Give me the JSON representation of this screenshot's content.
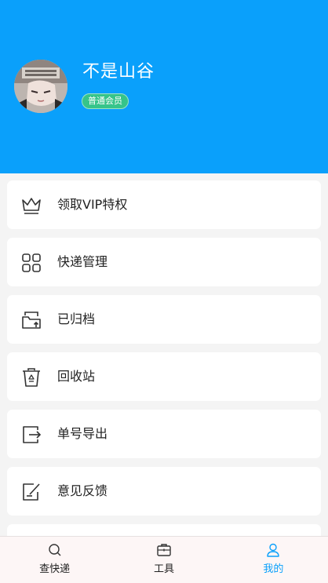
{
  "profile": {
    "username": "不是山谷",
    "badge": "普通会员"
  },
  "menu": {
    "items": [
      {
        "label": "领取VIP特权",
        "icon": "crown-icon"
      },
      {
        "label": "快递管理",
        "icon": "grid-icon"
      },
      {
        "label": "已归档",
        "icon": "archive-folder-icon"
      },
      {
        "label": "回收站",
        "icon": "recycle-bin-icon"
      },
      {
        "label": "单号导出",
        "icon": "export-icon"
      },
      {
        "label": "意见反馈",
        "icon": "feedback-edit-icon"
      }
    ]
  },
  "tabbar": {
    "tabs": [
      {
        "label": "查快递",
        "icon": "search-icon",
        "active": false
      },
      {
        "label": "工具",
        "icon": "toolbox-icon",
        "active": false
      },
      {
        "label": "我的",
        "icon": "user-icon",
        "active": true
      }
    ]
  },
  "colors": {
    "header": "#0aa0fb",
    "badge": "#36c48a",
    "active_tab": "#0aa0fb"
  }
}
